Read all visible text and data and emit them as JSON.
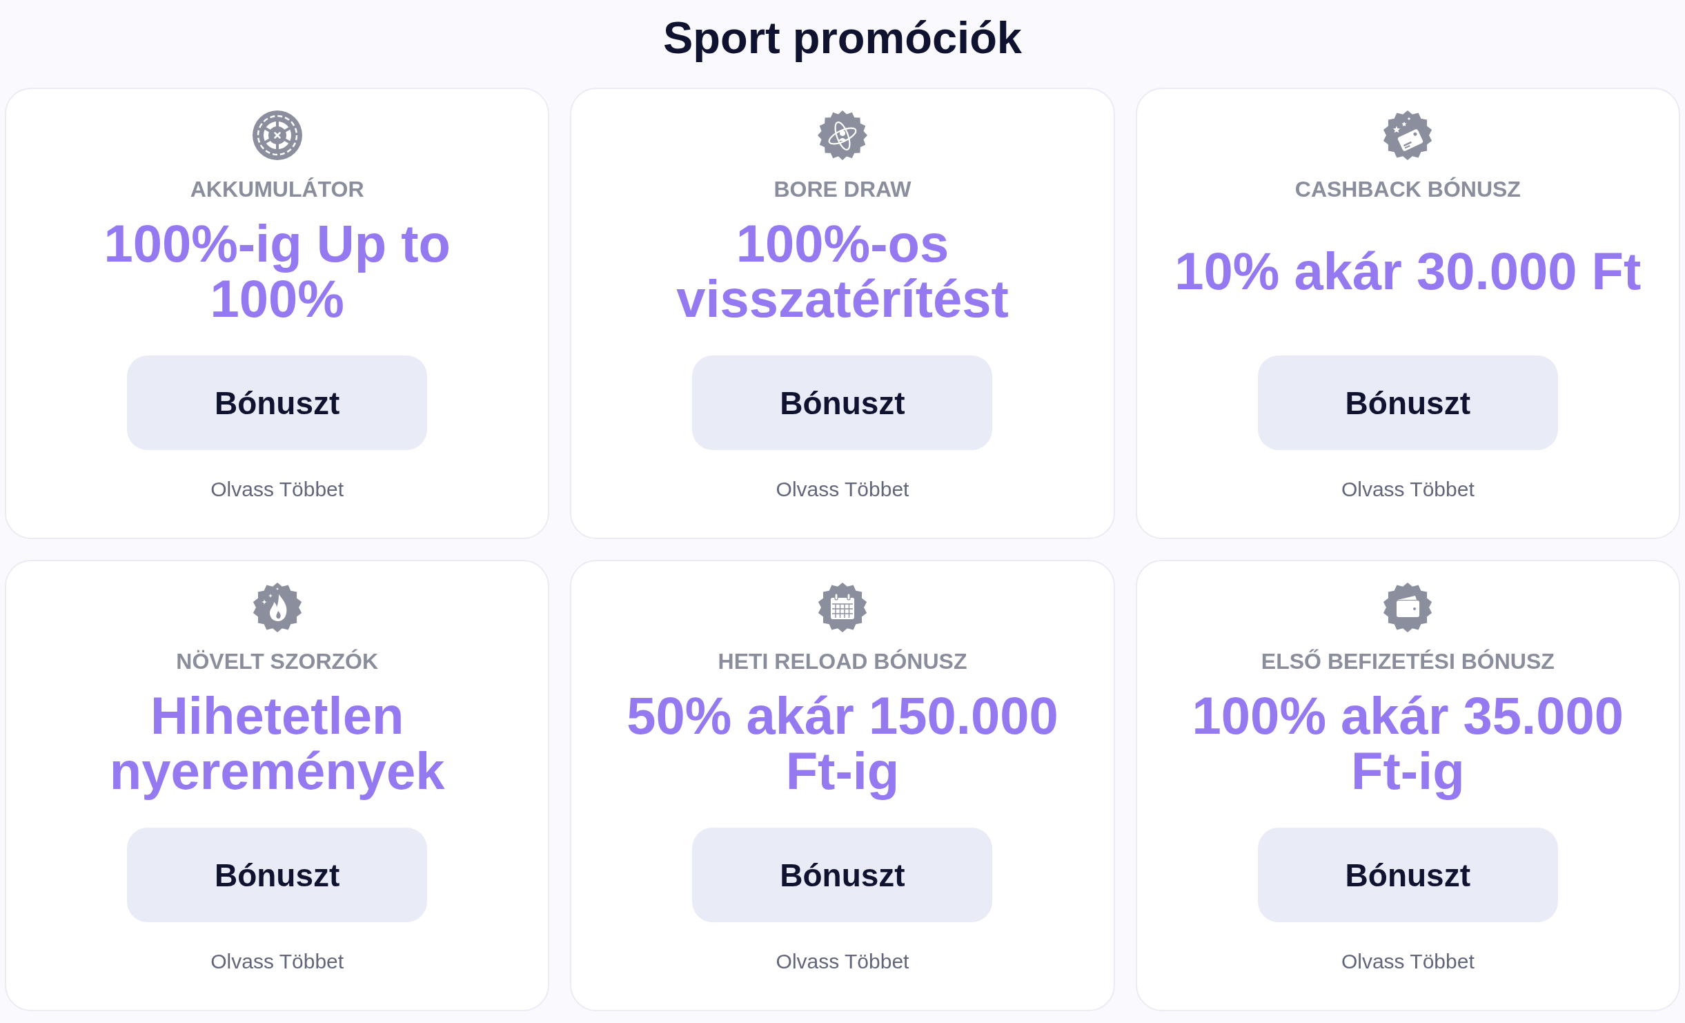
{
  "title": "Sport promóciók",
  "promotions": [
    {
      "category": "AKKUMULÁTOR",
      "headline": "100%-ig Up to 100%",
      "button": "Bónuszt",
      "link": "Olvass Többet"
    },
    {
      "category": "BORE DRAW",
      "headline": "100%-os visszatérítést",
      "button": "Bónuszt",
      "link": "Olvass Többet"
    },
    {
      "category": "CASHBACK BÓNUSZ",
      "headline": "10% akár 30.000 Ft",
      "button": "Bónuszt",
      "link": "Olvass Többet"
    },
    {
      "category": "NÖVELT SZORZÓK",
      "headline": "Hihetetlen nyeremények",
      "button": "Bónuszt",
      "link": "Olvass Többet"
    },
    {
      "category": "HETI RELOAD BÓNUSZ",
      "headline": "50% akár 150.000 Ft-ig",
      "button": "Bónuszt",
      "link": "Olvass Többet"
    },
    {
      "category": "ELSŐ BEFIZETÉSI BÓNUSZ",
      "headline": "100% akár 35.000 Ft-ig",
      "button": "Bónuszt",
      "link": "Olvass Többet"
    }
  ]
}
